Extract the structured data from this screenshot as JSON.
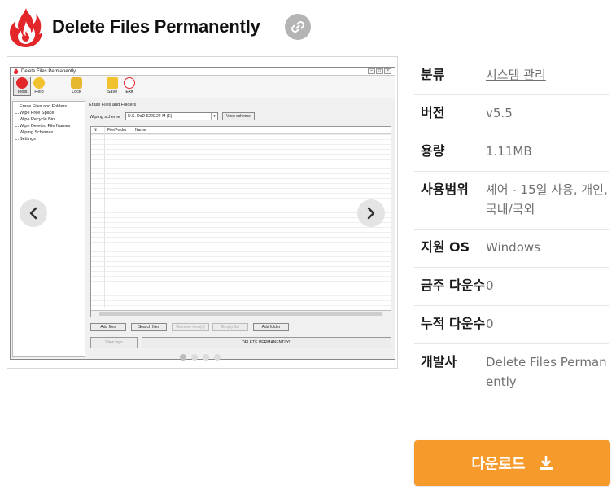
{
  "header": {
    "title": "Delete Files Permanently",
    "logo_icon": "flame-logo-icon",
    "link_icon": "link-icon"
  },
  "carousel": {
    "prev_icon": "chevron-left-icon",
    "next_icon": "chevron-right-icon",
    "dot_count": 4,
    "active_dot": 0,
    "screenshot": {
      "window_title": "Delete Files Permanently",
      "toolbar": [
        "Tools",
        "Help",
        "Lock",
        "Save",
        "Exit"
      ],
      "tree": [
        "Erase Files and Folders",
        "Wipe Free Space",
        "Wipe Recycle Bin",
        "Wipe Deleted File Names",
        "Wiping Schemes",
        "Settings"
      ],
      "panel_title": "Erase Files and Folders",
      "scheme_label": "Wiping scheme",
      "scheme_value": "U.S. DoD 5220.22-M (E)",
      "view_scheme": "View scheme",
      "columns": [
        "N",
        "File/Folder",
        "Name"
      ],
      "actions": [
        "Add files",
        "Search files",
        "Remove item(s)",
        "Empty list",
        "Add folder"
      ],
      "view_logs": "View logs",
      "delete_button": "DELETE PERMANENTLY!!"
    }
  },
  "info": [
    {
      "label": "분류",
      "value": "시스템 관리"
    },
    {
      "label": "버전",
      "value": "v5.5"
    },
    {
      "label": "용량",
      "value": "1.11MB"
    },
    {
      "label": "사용범위",
      "value": "셰어 - 15일 사용, 개인, 국내/국외"
    },
    {
      "label": "지원 OS",
      "value": "Windows"
    },
    {
      "label": "금주 다운수",
      "value": "0"
    },
    {
      "label": "누적 다운수",
      "value": "0"
    },
    {
      "label": "개발사",
      "value": "Delete Files Permanently"
    }
  ],
  "download": {
    "label": "다운로드",
    "icon": "download-icon"
  },
  "colors": {
    "accent": "#f59a2b",
    "logo_red": "#e3262a"
  }
}
